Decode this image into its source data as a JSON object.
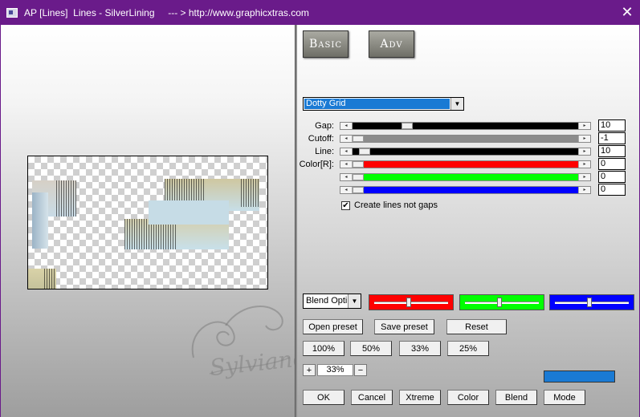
{
  "window": {
    "title": "AP [Lines]  Lines - SilverLining     --- > http://www.graphicxtras.com"
  },
  "tabs": {
    "basic_label": "Basic",
    "adv_label": "Adv"
  },
  "preset_select": {
    "value": "Dotty Grid"
  },
  "params": {
    "gap": {
      "label": "Gap:",
      "value": "10",
      "level": 0.23,
      "fill": "#000000"
    },
    "cutoff": {
      "label": "Cutoff:",
      "value": "-1",
      "level": 0.0,
      "fill": "#8c8c8c"
    },
    "line": {
      "label": "Line:",
      "value": "10",
      "level": 0.03,
      "fill": "#000000"
    },
    "color_r": {
      "label": "Color[R]:",
      "value": "0",
      "level": 0.0,
      "fill": "#ff0000"
    },
    "color_g": {
      "label": "",
      "value": "0",
      "level": 0.0,
      "fill": "#00ff00"
    },
    "color_b": {
      "label": "",
      "value": "0",
      "level": 0.0,
      "fill": "#0000ff"
    }
  },
  "create_lines": {
    "label": "Create lines not gaps",
    "checked": true
  },
  "blend_select": {
    "value": "Blend Optio"
  },
  "blend_colors": {
    "red": {
      "color": "#ff0000",
      "level": 0.45
    },
    "green": {
      "color": "#00ff00",
      "level": 0.45
    },
    "blue": {
      "color": "#0000ff",
      "level": 0.45
    }
  },
  "buttons": {
    "open_preset": "Open preset",
    "save_preset": "Save preset",
    "reset": "Reset",
    "zoom_100": "100%",
    "zoom_50": "50%",
    "zoom_33": "33%",
    "zoom_25": "25%",
    "zoom_plus": "+",
    "zoom_minus": "−",
    "ok": "OK",
    "cancel": "Cancel",
    "xtreme": "Xtreme",
    "color": "Color",
    "blend": "Blend",
    "mode": "Mode"
  },
  "zoom": {
    "value": "33%"
  },
  "accent_swatch": "#1a7ad4",
  "watermark": {
    "text": "Sylviane"
  },
  "icons": {
    "app": "app-window-icon",
    "close": "close-icon",
    "dropdown": "chevron-down-icon",
    "check": "check-icon"
  }
}
